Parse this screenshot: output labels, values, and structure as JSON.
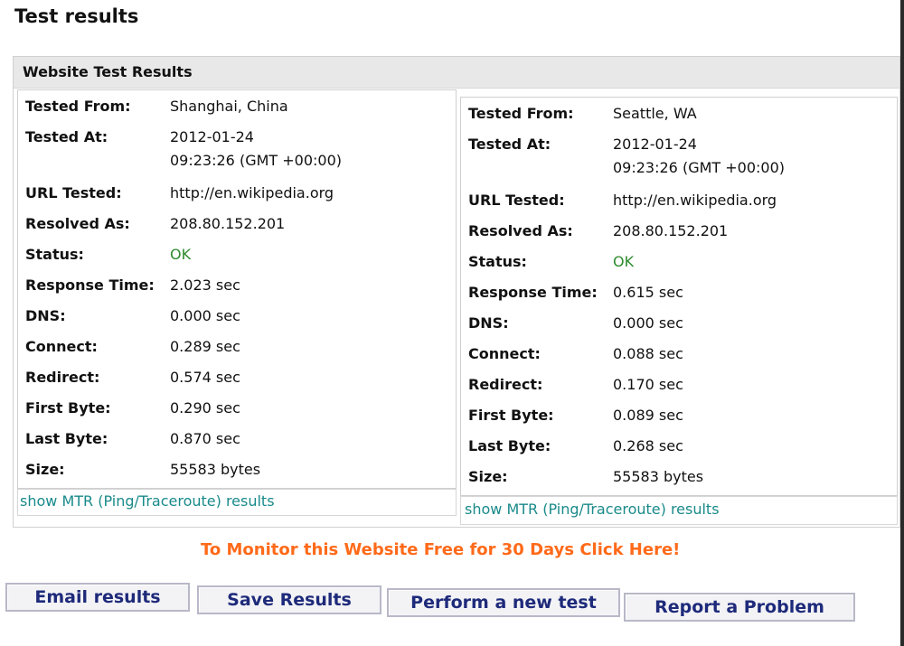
{
  "page": {
    "title": "Test results"
  },
  "results": {
    "header": "Website Test Results",
    "labels": {
      "tested_from": "Tested From:",
      "tested_at": "Tested At:",
      "url_tested": "URL Tested:",
      "resolved_as": "Resolved As:",
      "status": "Status:",
      "response_time": "Response Time:",
      "dns": "DNS:",
      "connect": "Connect:",
      "redirect": "Redirect:",
      "first_byte": "First Byte:",
      "last_byte": "Last Byte:",
      "size": "Size:"
    },
    "left": {
      "tested_from": "Shanghai, China",
      "tested_at_date": "2012-01-24",
      "tested_at_time": "09:23:26 (GMT +00:00)",
      "url_tested": "http://en.wikipedia.org",
      "resolved_as": "208.80.152.201",
      "status": "OK",
      "response_time": "2.023 sec",
      "dns": "0.000 sec",
      "connect": "0.289 sec",
      "redirect": "0.574 sec",
      "first_byte": "0.290 sec",
      "last_byte": "0.870 sec",
      "size": "55583 bytes",
      "mtr_link": "show MTR (Ping/Traceroute) results"
    },
    "right": {
      "tested_from": "Seattle, WA",
      "tested_at_date": "2012-01-24",
      "tested_at_time": "09:23:26 (GMT +00:00)",
      "url_tested": "http://en.wikipedia.org",
      "resolved_as": "208.80.152.201",
      "status": "OK",
      "response_time": "0.615 sec",
      "dns": "0.000 sec",
      "connect": "0.088 sec",
      "redirect": "0.170 sec",
      "first_byte": "0.089 sec",
      "last_byte": "0.268 sec",
      "size": "55583 bytes",
      "mtr_link": "show MTR (Ping/Traceroute) results"
    }
  },
  "promo": {
    "text": "To Monitor this Website Free for 30 Days Click Here!"
  },
  "buttons": {
    "email": "Email results",
    "save": "Save Results",
    "new_test": "Perform a new test",
    "report": "Report a Problem"
  },
  "colors": {
    "ok_status": "#2e8b2e",
    "link": "#1a8a8a",
    "promo": "#ff6a1a",
    "button_text": "#1e2a7a"
  }
}
